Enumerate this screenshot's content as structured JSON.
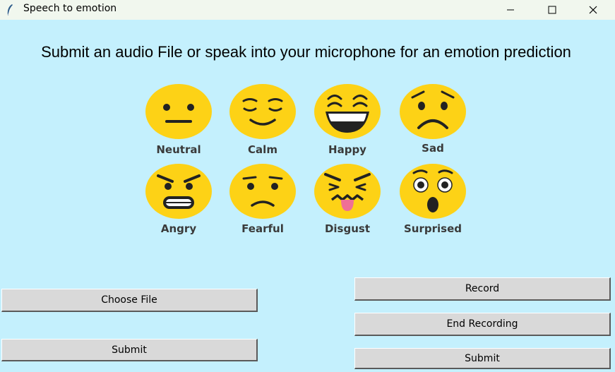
{
  "window": {
    "title": "Speech to emotion",
    "controls": {
      "minimize": "minimize-icon",
      "maximize": "maximize-icon",
      "close": "close-icon"
    }
  },
  "headline": "Submit an audio File or speak into your microphone for an emotion prediction",
  "emotions": [
    {
      "label": "Neutral",
      "icon": "neutral-face-icon"
    },
    {
      "label": "Calm",
      "icon": "calm-face-icon"
    },
    {
      "label": "Happy",
      "icon": "happy-face-icon"
    },
    {
      "label": "Sad",
      "icon": "sad-face-icon"
    },
    {
      "label": "Angry",
      "icon": "angry-face-icon"
    },
    {
      "label": "Fearful",
      "icon": "fearful-face-icon"
    },
    {
      "label": "Disgust",
      "icon": "disgust-face-icon"
    },
    {
      "label": "Surprised",
      "icon": "surprised-face-icon"
    }
  ],
  "file_panel": {
    "choose_label": "Choose File",
    "submit_label": "Submit"
  },
  "record_panel": {
    "record_label": "Record",
    "end_label": "End Recording",
    "submit_label": "Submit"
  },
  "colors": {
    "background": "#c4f0fd",
    "titlebar": "#f1f7ee",
    "button": "#d9d9d9",
    "emoji_yellow": "#fdd216"
  }
}
